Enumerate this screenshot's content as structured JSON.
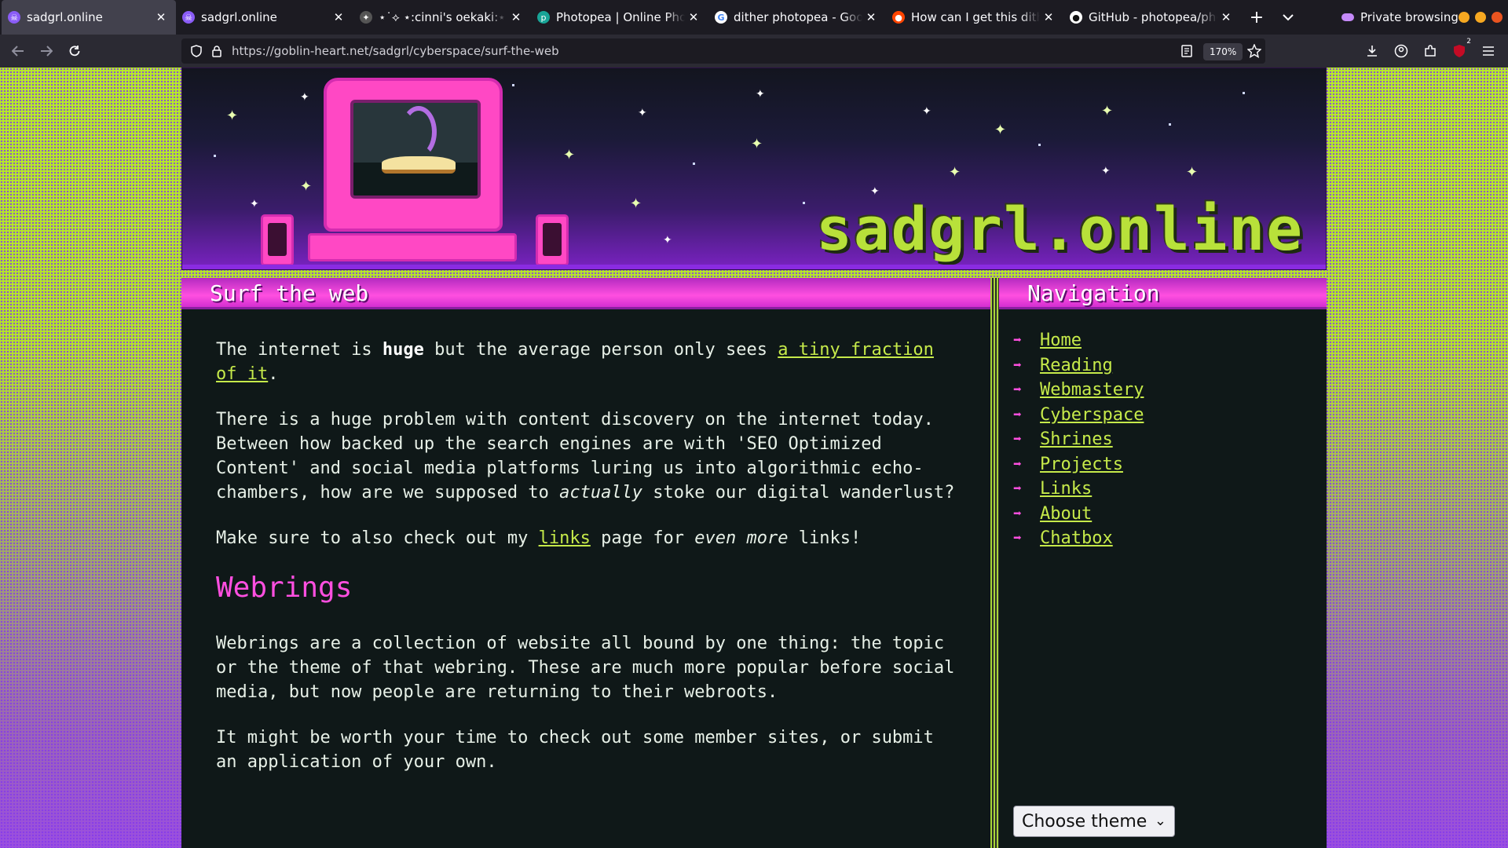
{
  "browser": {
    "tabs": [
      {
        "title": "sadgrl.online",
        "active": true,
        "favicon_color": "#8a5cf6"
      },
      {
        "title": "sadgrl.online",
        "active": false,
        "favicon_color": "#8a5cf6"
      },
      {
        "title": "⋆˙⟡ ⋆:cinni's oekaki:⋆˙⟡",
        "active": false,
        "favicon_color": "#555555"
      },
      {
        "title": "Photopea | Online Photo",
        "active": false,
        "favicon_color": "#18a497"
      },
      {
        "title": "dither photopea - Google",
        "active": false,
        "favicon_color": "#4285f4"
      },
      {
        "title": "How can I get this dither",
        "active": false,
        "favicon_color": "#ff4500"
      },
      {
        "title": "GitHub - photopea/photo",
        "active": false,
        "favicon_color": "#ffffff"
      }
    ],
    "new_tab": "+",
    "private_label": "Private browsing",
    "url": "https://goblin-heart.net/sadgrl/cyberspace/surf-the-web",
    "zoom": "170%",
    "extension_badge": "2",
    "window_buttons": [
      "#ffbd2e",
      "#ffbd2e",
      "#e95420"
    ]
  },
  "site": {
    "logo": "sadgrl.online",
    "main_panel": {
      "heading": "Surf the web",
      "p1_pre": "The internet is ",
      "p1_bold": "huge",
      "p1_mid": " but the average person only sees ",
      "p1_link": "a tiny fraction of it",
      "p1_post": ".",
      "p2_pre": "There is a huge problem with content discovery on the internet today. Between how backed up the search engines are with 'SEO Optimized Content' and social media platforms luring us into algorithmic echo-chambers, how are we supposed to ",
      "p2_em": "actually",
      "p2_post": " stoke our digital wanderlust?",
      "p3_pre": "Make sure to also check out my ",
      "p3_link": "links",
      "p3_mid": " page for ",
      "p3_em": "even more",
      "p3_post": " links!",
      "webrings_heading": "Webrings",
      "p4": "Webrings are a collection of website all bound by one thing: the topic or the theme of that webring. These are much more popular before social media, but now people are returning to their webroots.",
      "p5": "It might be worth your time to check out some member sites, or submit an application of your own."
    },
    "nav_panel": {
      "heading": "Navigation",
      "items": [
        "Home",
        "Reading",
        "Webmastery",
        "Cyberspace",
        "Shrines",
        "Projects",
        "Links",
        "About",
        "Chatbox"
      ]
    },
    "theme_select": {
      "selected": "Choose theme"
    }
  },
  "colors": {
    "accent_pink": "#ff4fe0",
    "link_green": "#c6ea4a",
    "panel_bg": "#0f1818"
  }
}
